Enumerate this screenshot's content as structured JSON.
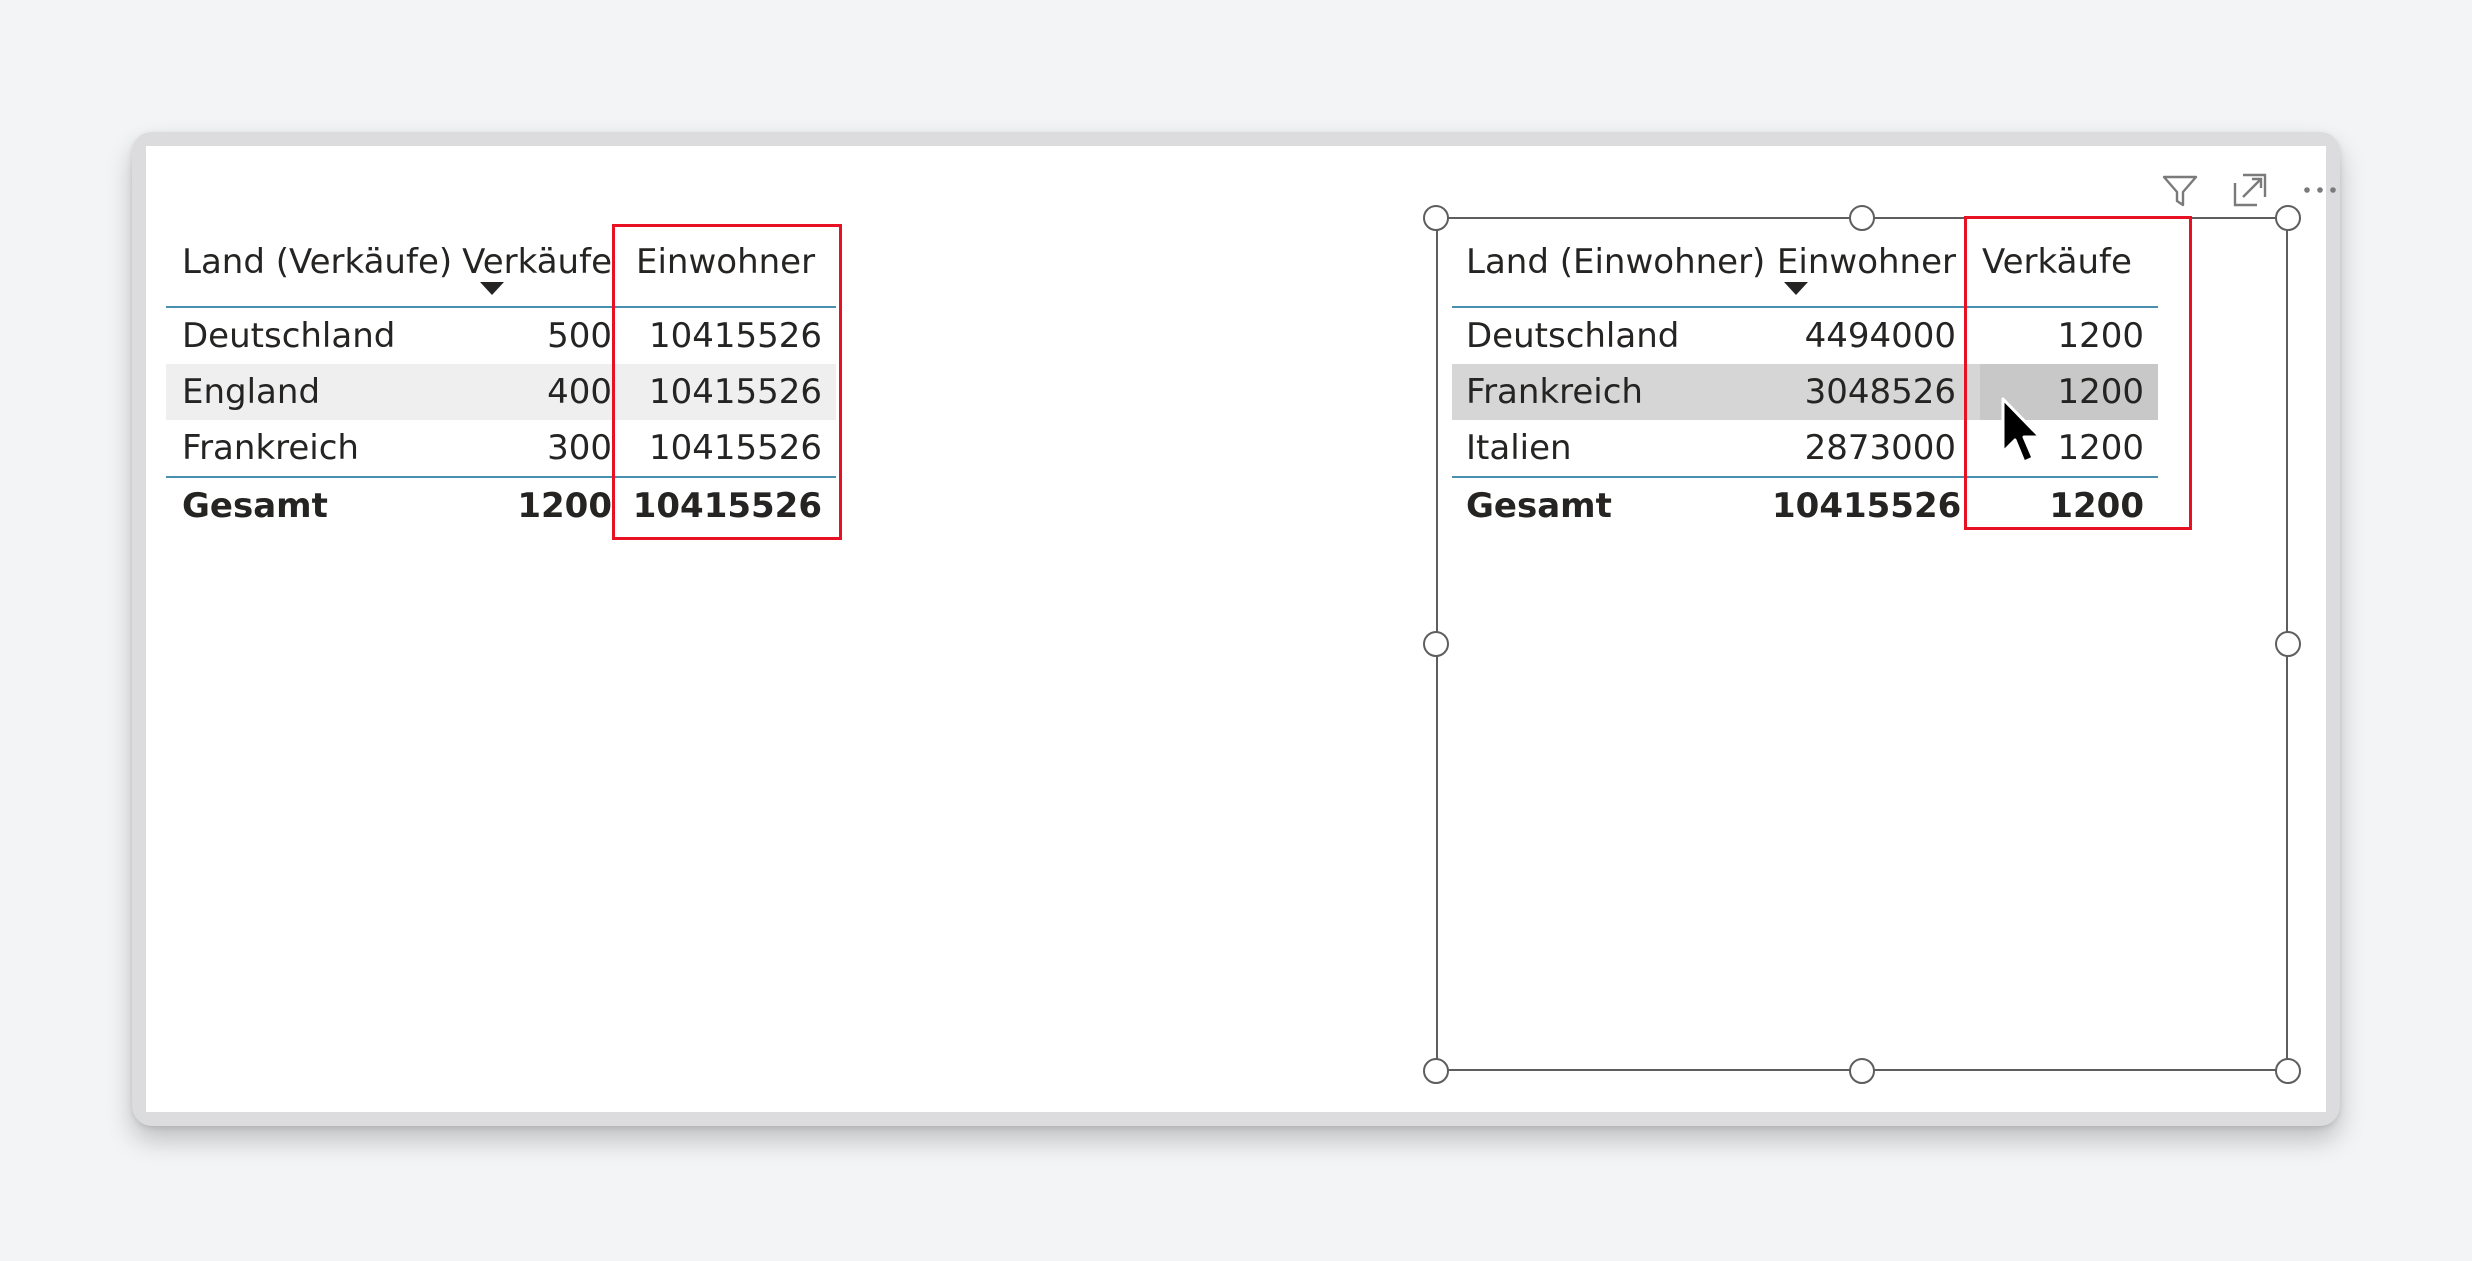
{
  "left_table": {
    "columns": [
      {
        "label": "Land (Verkäufe)"
      },
      {
        "label": "Verkäufe",
        "sorted": true
      },
      {
        "label": "Einwohner"
      }
    ],
    "rows": [
      {
        "land": "Deutschland",
        "verkaeufe": "500",
        "einwohner": "10415526"
      },
      {
        "land": "England",
        "verkaeufe": "400",
        "einwohner": "10415526"
      },
      {
        "land": "Frankreich",
        "verkaeufe": "300",
        "einwohner": "10415526"
      }
    ],
    "total": {
      "land": "Gesamt",
      "verkaeufe": "1200",
      "einwohner": "10415526"
    }
  },
  "right_table": {
    "columns": [
      {
        "label": "Land (Einwohner)"
      },
      {
        "label": "Einwohner",
        "sorted": true
      },
      {
        "label": "Verkäufe"
      }
    ],
    "rows": [
      {
        "land": "Deutschland",
        "einwohner": "4494000",
        "verkaeufe": "1200"
      },
      {
        "land": "Frankreich",
        "einwohner": "3048526",
        "verkaeufe": "1200"
      },
      {
        "land": "Italien",
        "einwohner": "2873000",
        "verkaeufe": "1200"
      }
    ],
    "total": {
      "land": "Gesamt",
      "einwohner": "10415526",
      "verkaeufe": "1200"
    }
  },
  "visual_header_icons": [
    "filter-icon",
    "focus-mode-icon",
    "more-options-icon"
  ],
  "colors": {
    "highlight_box": "#e81123",
    "header_rule": "#4a8fb0",
    "selection_frame": "#5e5e5e",
    "row_alt": "#efefef",
    "row_selected": "#d6d6d6"
  }
}
